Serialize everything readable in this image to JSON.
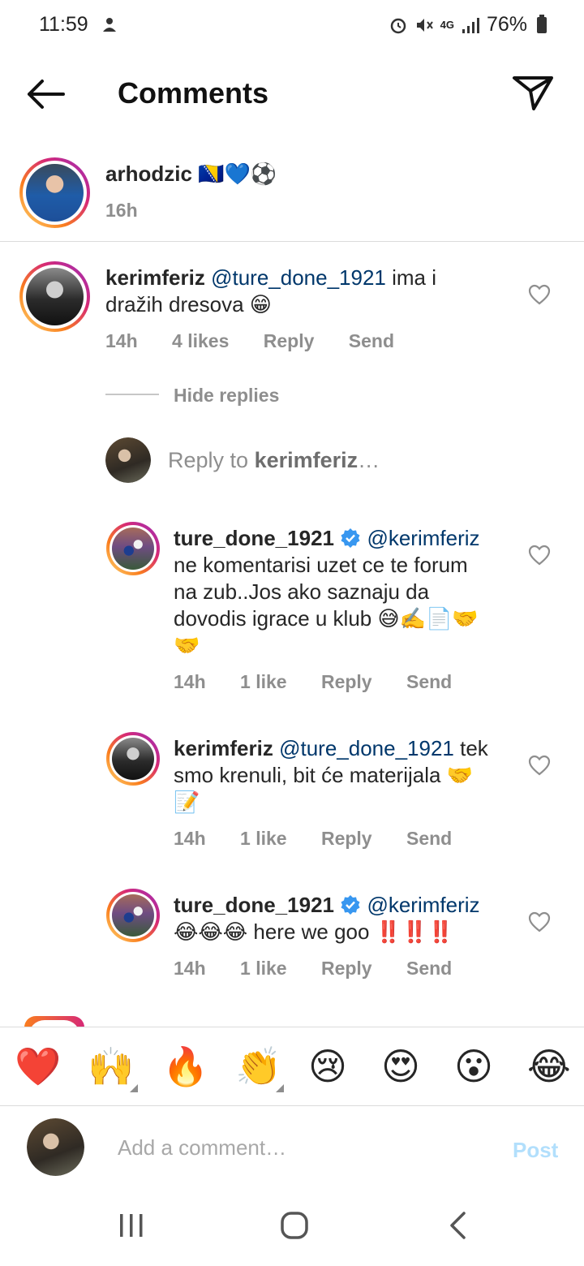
{
  "status": {
    "time": "11:59",
    "battery": "76%",
    "network": "4G"
  },
  "header": {
    "title": "Comments"
  },
  "caption": {
    "username": "arhodzic",
    "emojis": "🇧🇦💙⚽",
    "time": "16h"
  },
  "comments": [
    {
      "username": "kerimferiz",
      "mention": "@ture_done_1921",
      "text_line1": " ima i",
      "text_line2": "dražih dresova 😁",
      "time": "14h",
      "likes": "4 likes",
      "reply": "Reply",
      "send": "Send"
    }
  ],
  "hide_replies": "Hide replies",
  "reply_prompt": {
    "prefix": "Reply to ",
    "username": "kerimferiz",
    "suffix": "…"
  },
  "replies": [
    {
      "username": "ture_done_1921",
      "verified": true,
      "mention": "@kerimferiz",
      "line2": "ne komentarisi uzet ce te forum",
      "line3": "na zub..Jos ako saznaju da",
      "line4": "dovodis igrace u klub 😅✍️📄🤝",
      "line5": "🤝",
      "time": "14h",
      "likes": "1 like",
      "reply": "Reply",
      "send": "Send"
    },
    {
      "username": "kerimferiz",
      "mention": "@ture_done_1921",
      "line1_tail": " tek",
      "line2": "smo krenuli, bit će materijala 🤝",
      "line3": "📝",
      "time": "14h",
      "likes": "1 like",
      "reply": "Reply",
      "send": "Send"
    },
    {
      "username": "ture_done_1921",
      "verified": true,
      "mention": "@kerimferiz",
      "line2": "😂😂😂 here we goo ‼️‼️‼️",
      "time": "14h",
      "likes": "1 like",
      "reply": "Reply",
      "send": "Send"
    }
  ],
  "emoji_bar": [
    "❤️",
    "🙌",
    "🔥",
    "👏",
    "😢",
    "😍",
    "😮",
    "😂"
  ],
  "composer": {
    "placeholder": "Add a comment…",
    "post": "Post"
  },
  "colors": {
    "mention": "#00376b",
    "muted": "#8e8e8e",
    "post_disabled": "#b2dffc",
    "verified": "#3897f0"
  },
  "icons": [
    "back-arrow-icon",
    "send-icon",
    "heart-icon",
    "verified-icon",
    "recent-apps-icon",
    "home-icon",
    "back-nav-icon"
  ]
}
